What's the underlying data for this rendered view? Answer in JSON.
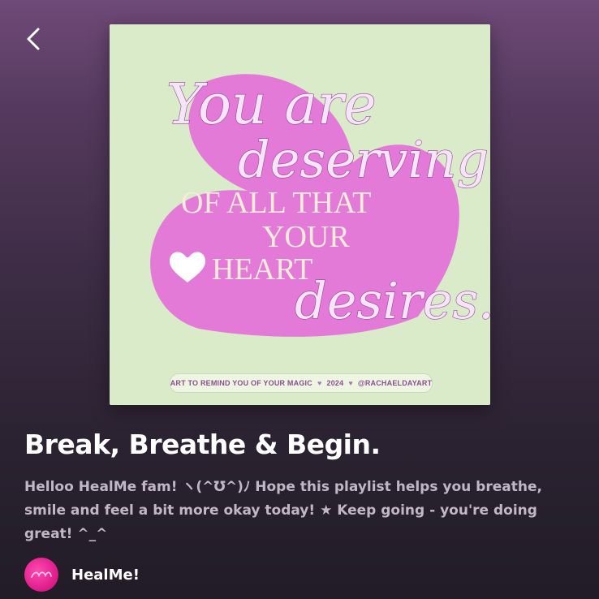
{
  "header": {
    "back_icon": "chevron-left-icon"
  },
  "cover": {
    "line_script_1": "You are",
    "line_script_2": "deserving",
    "line_caps_1": "OF ALL THAT",
    "line_caps_2": "YOUR",
    "line_caps_3": "HEART",
    "line_script_3": "desires.",
    "credit_left": "ART TO REMIND YOU OF YOUR MAGIC",
    "credit_year": "2024",
    "credit_handle": "@RACHAELDAYART",
    "colors": {
      "background": "#d9ebc8",
      "heart": "#e37ad8",
      "small_heart": "#ffffff"
    }
  },
  "playlist": {
    "title": "Break, Breathe & Begin.",
    "description": "Helloo HealMe fam! ヽ(^Ʊ^)ﾉ Hope this playlist helps you breathe, smile and feel a bit more okay today! ★ Keep going - you're doing great! ^_^",
    "owner": {
      "name": "HealMe!",
      "avatar_color": "#e21f8f"
    }
  }
}
